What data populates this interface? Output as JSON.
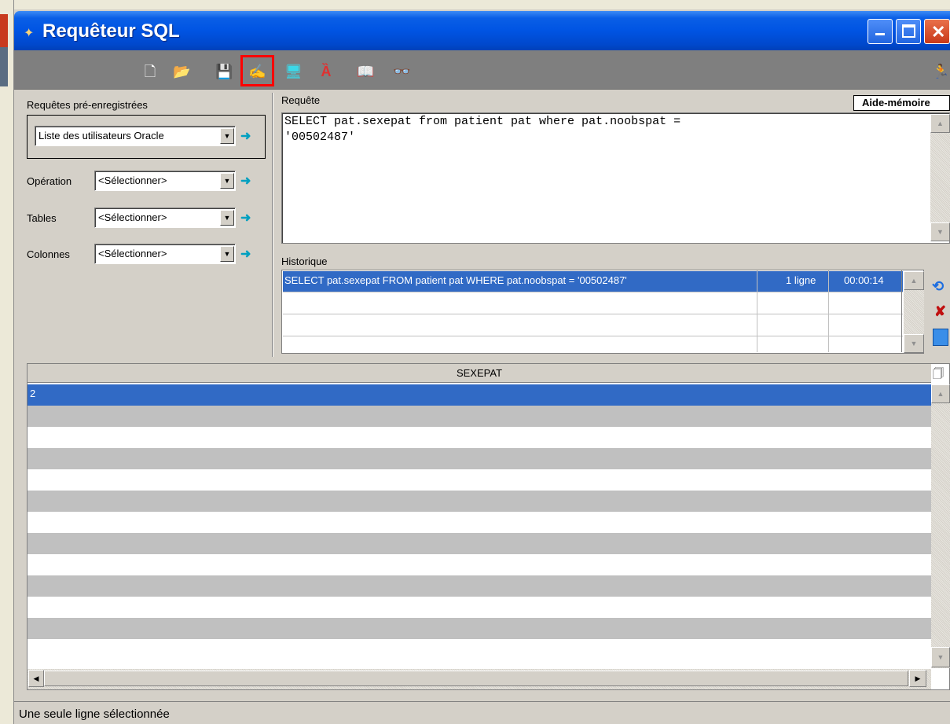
{
  "window": {
    "title": "Requêteur SQL"
  },
  "toolbar": {
    "icons": [
      "new-icon",
      "open-icon",
      "save-icon",
      "edit-query-icon",
      "execute-icon",
      "oracle-icon",
      "book-icon",
      "glasses-icon",
      "exit-icon"
    ]
  },
  "left": {
    "preregistered_label": "Requêtes pré-enregistrées",
    "preregistered_value": "Liste des utilisateurs Oracle",
    "operation_label": "Opération",
    "operation_value": "<Sélectionner>",
    "tables_label": "Tables",
    "tables_value": "<Sélectionner>",
    "columns_label": "Colonnes",
    "columns_value": "<Sélectionner>"
  },
  "query": {
    "label": "Requête",
    "text": "SELECT pat.sexepat from patient pat where pat.noobspat =\n'00502487'",
    "aide_label": "Aide-mémoire"
  },
  "history": {
    "label": "Historique",
    "rows": [
      {
        "query": "SELECT pat.sexepat FROM patient pat WHERE pat.noobspat = '00502487'",
        "count": "1 ligne",
        "time": "00:00:14"
      }
    ]
  },
  "results": {
    "column": "SEXEPAT",
    "rows": [
      "2"
    ]
  },
  "status": {
    "text": "Une seule ligne sélectionnée"
  }
}
